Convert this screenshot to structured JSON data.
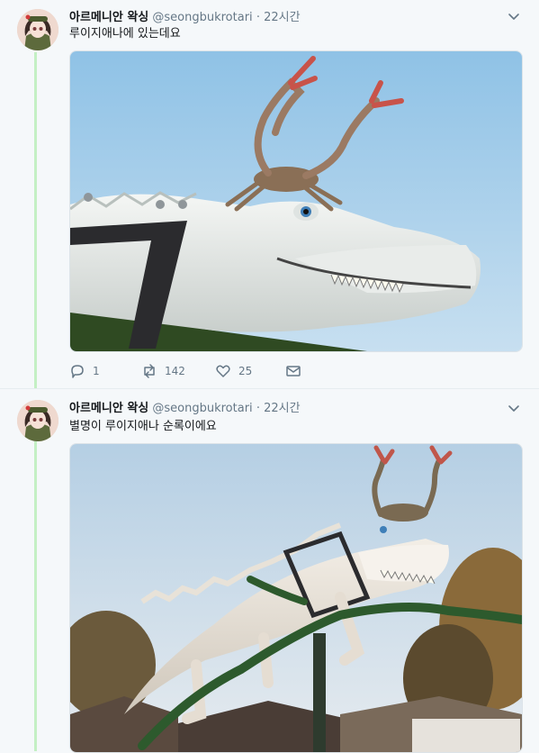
{
  "tweets": [
    {
      "author": {
        "name": "아르메니안 왁싱",
        "handle": "@seongbukrotari"
      },
      "separator": "·",
      "time": "22시간",
      "text": "루이지애나에 있는데요",
      "stats": {
        "replies": "1",
        "retweets": "142",
        "likes": "25"
      }
    },
    {
      "author": {
        "name": "아르메니안 왁싱",
        "handle": "@seongbukrotari"
      },
      "separator": "·",
      "time": "22시간",
      "text": "별명이 루이지애나 순록이에요"
    }
  ],
  "icons": {
    "reply": "reply-icon",
    "retweet": "retweet-icon",
    "like": "heart-icon",
    "dm": "envelope-icon",
    "more": "chevron-down-icon"
  },
  "colors": {
    "background": "#f5f8fa",
    "thread_line": "#c4f0c4",
    "secondary_text": "#657786",
    "sky_1": "#9ec8e6",
    "sky_2": "#dfe7ee"
  }
}
